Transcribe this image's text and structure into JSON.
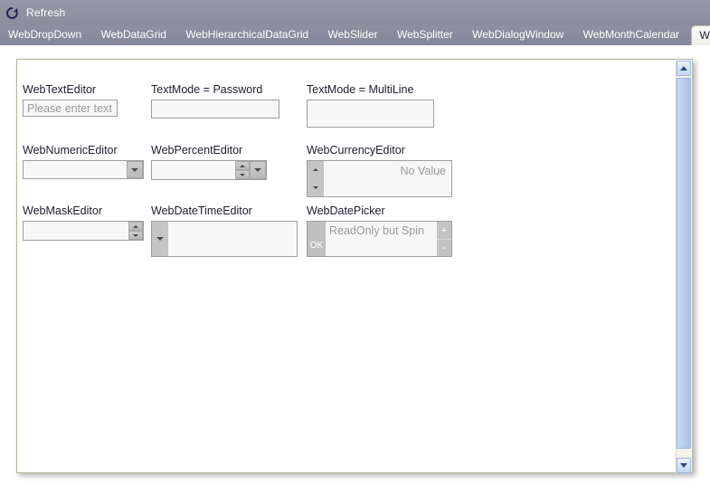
{
  "titlebar": {
    "refresh_label": "Refresh",
    "refresh_icon": "refresh-circular-arrow-icon"
  },
  "tabs": [
    {
      "label": "WebDropDown",
      "selected": false
    },
    {
      "label": "WebDataGrid",
      "selected": false
    },
    {
      "label": "WebHierarchicalDataGrid",
      "selected": false
    },
    {
      "label": "WebSlider",
      "selected": false
    },
    {
      "label": "WebSplitter",
      "selected": false
    },
    {
      "label": "WebDialogWindow",
      "selected": false
    },
    {
      "label": "WebMonthCalendar",
      "selected": false
    },
    {
      "label": "WebTextEditors",
      "selected": true
    },
    {
      "label": "W",
      "selected": false
    }
  ],
  "editors": {
    "text_editor": {
      "label": "WebTextEditor",
      "placeholder": "Please enter text",
      "value": ""
    },
    "password_editor": {
      "label": "TextMode = Password",
      "value": ""
    },
    "multiline_editor": {
      "label": "TextMode = MultiLine",
      "value": ""
    },
    "numeric_editor": {
      "label": "WebNumericEditor",
      "value": "",
      "dropdown_icon": "chevron-down-icon"
    },
    "percent_editor": {
      "label": "WebPercentEditor",
      "value": "",
      "spin_up_icon": "chevron-up-icon",
      "spin_down_icon": "chevron-down-icon",
      "dropdown_icon": "chevron-down-icon"
    },
    "currency_editor": {
      "label": "WebCurrencyEditor",
      "value": "No Value",
      "spin_up_icon": "chevron-up-icon",
      "spin_down_icon": "chevron-down-icon"
    },
    "mask_editor": {
      "label": "WebMaskEditor",
      "value": "",
      "spin_up_icon": "chevron-up-icon",
      "spin_down_icon": "chevron-down-icon"
    },
    "datetime_editor": {
      "label": "WebDateTimeEditor",
      "value": "",
      "dropdown_icon": "chevron-down-icon"
    },
    "date_picker": {
      "label": "WebDatePicker",
      "value": "ReadOnly but Spin",
      "ok_label": "OK",
      "plus_label": "+",
      "minus_label": "-"
    }
  },
  "scrollbar": {
    "up_icon": "scroll-up-arrow-icon",
    "down_icon": "scroll-down-arrow-icon"
  }
}
